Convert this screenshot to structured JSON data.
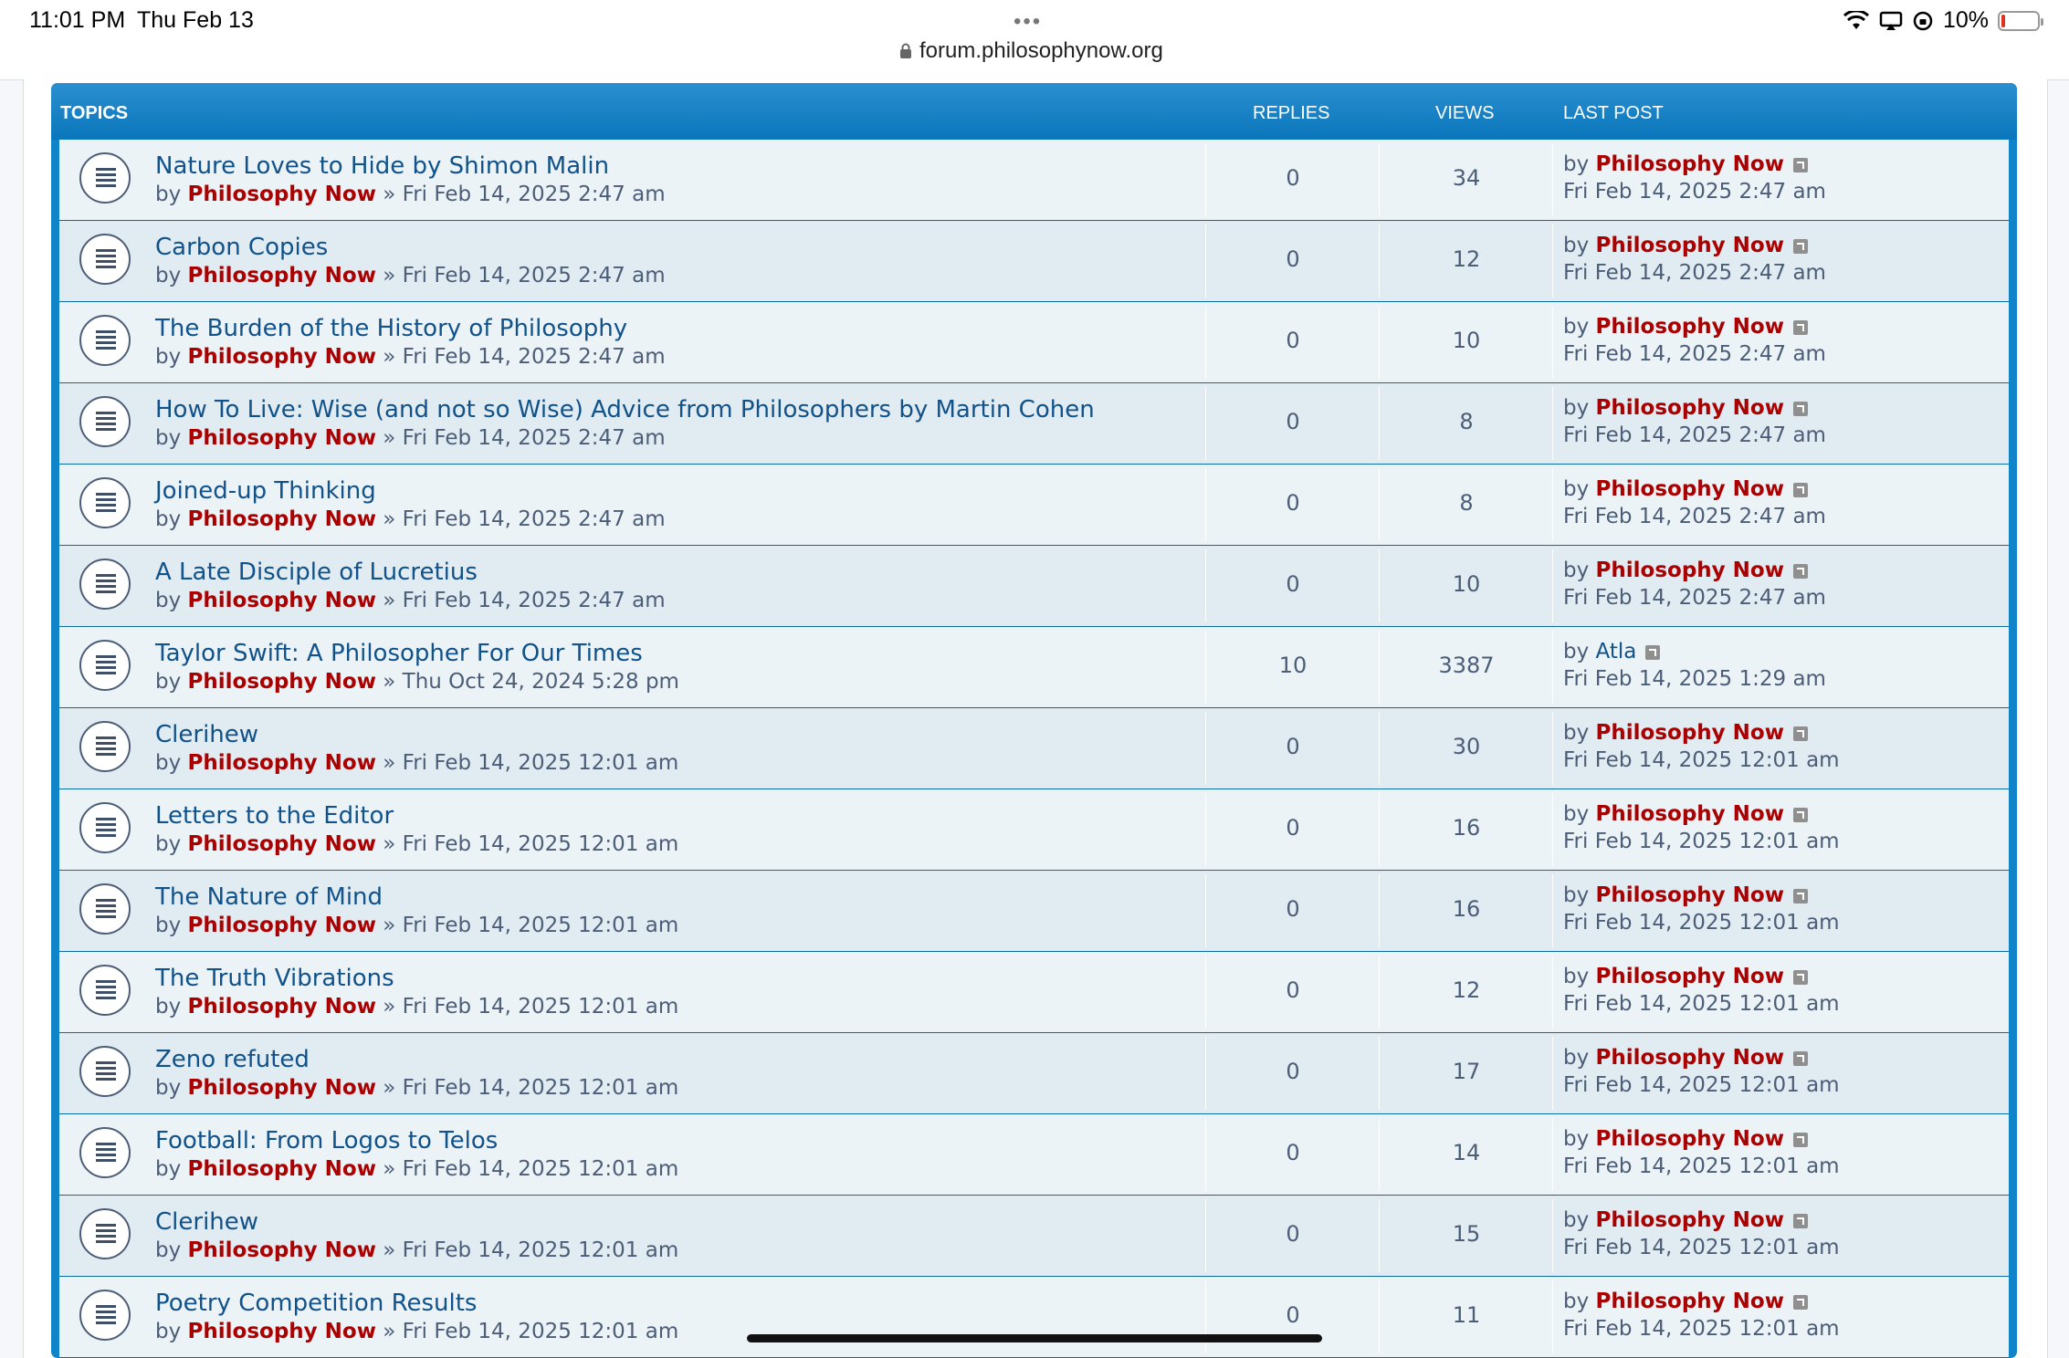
{
  "status_bar": {
    "time": "11:01 PM",
    "date": "Thu Feb 13",
    "dots": "•••",
    "url": "forum.philosophynow.org",
    "battery": "10%",
    "battery_level": 0.1,
    "icons": [
      "wifi-icon",
      "airplay-icon",
      "orientation-lock-icon",
      "battery-icon"
    ]
  },
  "table_header": {
    "topics": "TOPICS",
    "replies": "REPLIES",
    "views": "VIEWS",
    "last_post": "LAST POST"
  },
  "labels": {
    "by": "by",
    "sep": "»"
  },
  "colors": {
    "header": "#0f84c9",
    "title": "#105289",
    "author": "#aa0000",
    "meta": "#4c5d77"
  },
  "topics": [
    {
      "title": "Nature Loves to Hide by Shimon Malin",
      "author": "Philosophy Now",
      "posted": "Fri Feb 14, 2025 2:47 am",
      "replies": "0",
      "views": "34",
      "last_author": "Philosophy Now",
      "last_date": "Fri Feb 14, 2025 2:47 am"
    },
    {
      "title": "Carbon Copies",
      "author": "Philosophy Now",
      "posted": "Fri Feb 14, 2025 2:47 am",
      "replies": "0",
      "views": "12",
      "last_author": "Philosophy Now",
      "last_date": "Fri Feb 14, 2025 2:47 am"
    },
    {
      "title": "The Burden of the History of Philosophy",
      "author": "Philosophy Now",
      "posted": "Fri Feb 14, 2025 2:47 am",
      "replies": "0",
      "views": "10",
      "last_author": "Philosophy Now",
      "last_date": "Fri Feb 14, 2025 2:47 am"
    },
    {
      "title": "How To Live: Wise (and not so Wise) Advice from Philosophers by Martin Cohen",
      "author": "Philosophy Now",
      "posted": "Fri Feb 14, 2025 2:47 am",
      "replies": "0",
      "views": "8",
      "last_author": "Philosophy Now",
      "last_date": "Fri Feb 14, 2025 2:47 am"
    },
    {
      "title": "Joined-up Thinking",
      "author": "Philosophy Now",
      "posted": "Fri Feb 14, 2025 2:47 am",
      "replies": "0",
      "views": "8",
      "last_author": "Philosophy Now",
      "last_date": "Fri Feb 14, 2025 2:47 am"
    },
    {
      "title": "A Late Disciple of Lucretius",
      "author": "Philosophy Now",
      "posted": "Fri Feb 14, 2025 2:47 am",
      "replies": "0",
      "views": "10",
      "last_author": "Philosophy Now",
      "last_date": "Fri Feb 14, 2025 2:47 am"
    },
    {
      "title": "Taylor Swift: A Philosopher For Our Times",
      "author": "Philosophy Now",
      "posted": "Thu Oct 24, 2024 5:28 pm",
      "replies": "10",
      "views": "3387",
      "last_author": "Atla",
      "last_date": "Fri Feb 14, 2025 1:29 am",
      "last_plain": true
    },
    {
      "title": "Clerihew",
      "author": "Philosophy Now",
      "posted": "Fri Feb 14, 2025 12:01 am",
      "replies": "0",
      "views": "30",
      "last_author": "Philosophy Now",
      "last_date": "Fri Feb 14, 2025 12:01 am"
    },
    {
      "title": "Letters to the Editor",
      "author": "Philosophy Now",
      "posted": "Fri Feb 14, 2025 12:01 am",
      "replies": "0",
      "views": "16",
      "last_author": "Philosophy Now",
      "last_date": "Fri Feb 14, 2025 12:01 am"
    },
    {
      "title": "The Nature of Mind",
      "author": "Philosophy Now",
      "posted": "Fri Feb 14, 2025 12:01 am",
      "replies": "0",
      "views": "16",
      "last_author": "Philosophy Now",
      "last_date": "Fri Feb 14, 2025 12:01 am"
    },
    {
      "title": "The Truth Vibrations",
      "author": "Philosophy Now",
      "posted": "Fri Feb 14, 2025 12:01 am",
      "replies": "0",
      "views": "12",
      "last_author": "Philosophy Now",
      "last_date": "Fri Feb 14, 2025 12:01 am"
    },
    {
      "title": "Zeno refuted",
      "author": "Philosophy Now",
      "posted": "Fri Feb 14, 2025 12:01 am",
      "replies": "0",
      "views": "17",
      "last_author": "Philosophy Now",
      "last_date": "Fri Feb 14, 2025 12:01 am"
    },
    {
      "title": "Football: From Logos to Telos",
      "author": "Philosophy Now",
      "posted": "Fri Feb 14, 2025 12:01 am",
      "replies": "0",
      "views": "14",
      "last_author": "Philosophy Now",
      "last_date": "Fri Feb 14, 2025 12:01 am"
    },
    {
      "title": "Clerihew",
      "author": "Philosophy Now",
      "posted": "Fri Feb 14, 2025 12:01 am",
      "replies": "0",
      "views": "15",
      "last_author": "Philosophy Now",
      "last_date": "Fri Feb 14, 2025 12:01 am"
    },
    {
      "title": "Poetry Competition Results",
      "author": "Philosophy Now",
      "posted": "Fri Feb 14, 2025 12:01 am",
      "replies": "0",
      "views": "11",
      "last_author": "Philosophy Now",
      "last_date": "Fri Feb 14, 2025 12:01 am"
    }
  ]
}
